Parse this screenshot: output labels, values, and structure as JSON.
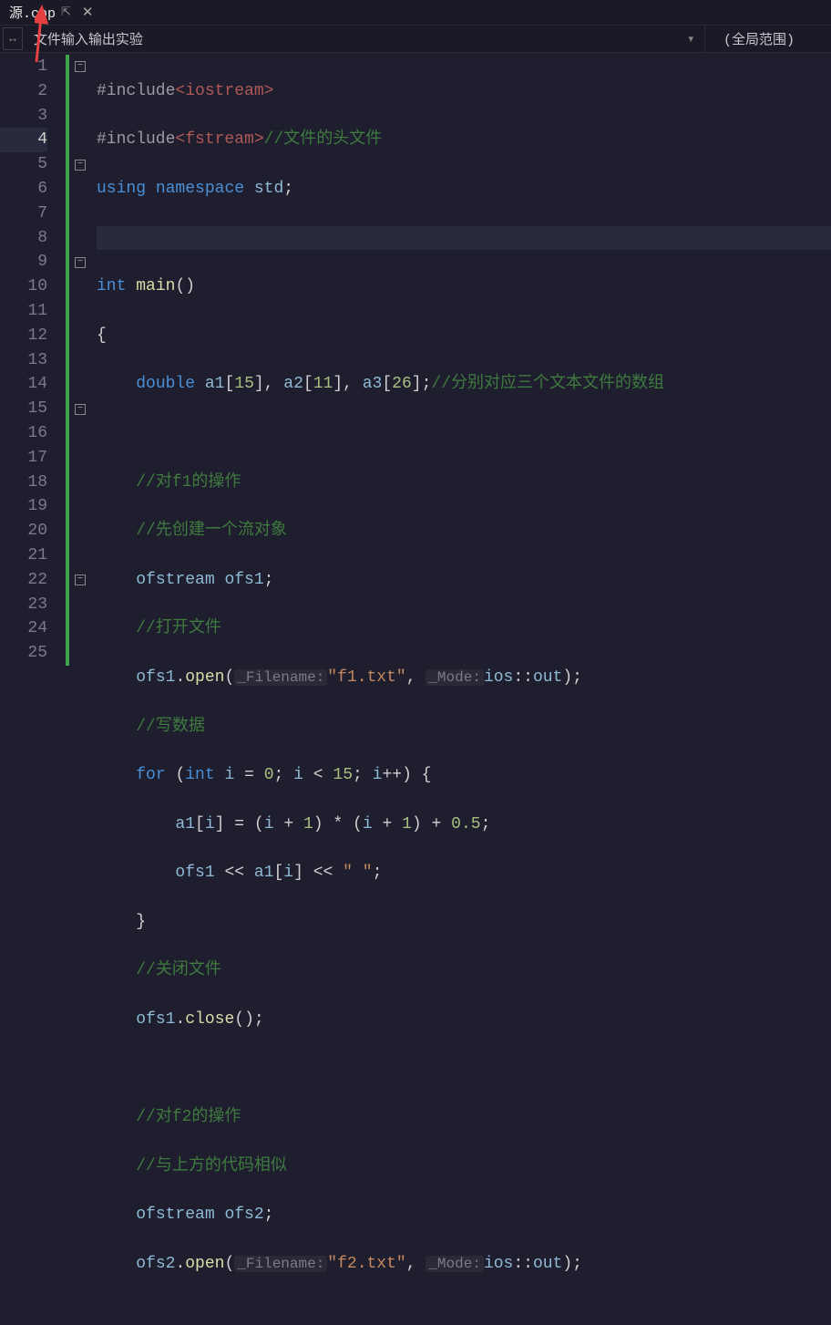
{
  "tab": {
    "name": "源.cpp"
  },
  "nav": {
    "breadcrumb": "文件输入输出实验",
    "scope": "(全局范围)"
  },
  "gutter": [
    "1",
    "2",
    "3",
    "4",
    "5",
    "6",
    "7",
    "8",
    "9",
    "10",
    "11",
    "12",
    "13",
    "14",
    "15",
    "16",
    "17",
    "18",
    "19",
    "20",
    "21",
    "22",
    "23",
    "24",
    "25"
  ],
  "code": {
    "l1_pp": "#include",
    "l1_hdr": "<iostream>",
    "l2_pp": "#include",
    "l2_hdr": "<fstream>",
    "l2_cmt": "//文件的头文件",
    "l3_kw1": "using",
    "l3_kw2": "namespace",
    "l3_id": "std",
    "l5_type": "int",
    "l5_fn": "main",
    "l6_brace": "{",
    "l7_type": "double",
    "l7_v1": "a1",
    "l7_n1": "15",
    "l7_v2": "a2",
    "l7_n2": "11",
    "l7_v3": "a3",
    "l7_n3": "26",
    "l7_cmt": "//分别对应三个文本文件的数组",
    "l9_cmt": "//对f1的操作",
    "l10_cmt": "//先创建一个流对象",
    "l11_type": "ofstream",
    "l11_v": "ofs1",
    "l12_cmt": "//打开文件",
    "l13_v": "ofs1",
    "l13_fn": "open",
    "l13_h1": "_Filename:",
    "l13_s": "\"f1.txt\"",
    "l13_h2": "_Mode:",
    "l13_id": "ios",
    "l13_m": "out",
    "l14_cmt": "//写数据",
    "l15_kw": "for",
    "l15_t": "int",
    "l15_v": "i",
    "l15_n0": "0",
    "l15_n1": "15",
    "l16_v1": "a1",
    "l16_v2": "i",
    "l16_n1": "1",
    "l16_n2": "1",
    "l16_n3": "0.5",
    "l17_v1": "ofs1",
    "l17_v2": "a1",
    "l17_v3": "i",
    "l17_s": "\" \"",
    "l18_brace": "}",
    "l19_cmt": "//关闭文件",
    "l20_v": "ofs1",
    "l20_fn": "close",
    "l22_cmt": "//对f2的操作",
    "l23_cmt": "//与上方的代码相似",
    "l24_type": "ofstream",
    "l24_v": "ofs2",
    "l25_v": "ofs2",
    "l25_fn": "open",
    "l25_h1": "_Filename:",
    "l25_s": "\"f2.txt\"",
    "l25_h2": "_Mode:",
    "l25_id": "ios",
    "l25_m": "out"
  }
}
